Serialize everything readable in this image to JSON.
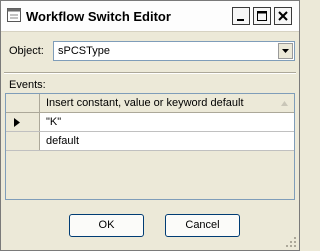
{
  "window": {
    "title": "Workflow Switch Editor"
  },
  "object": {
    "label": "Object:",
    "value": "sPCSType"
  },
  "events": {
    "label": "Events:",
    "column_header": "Insert constant, value or keyword default",
    "rows": [
      "\"K\"",
      "default"
    ]
  },
  "buttons": {
    "ok": "OK",
    "cancel": "Cancel"
  }
}
